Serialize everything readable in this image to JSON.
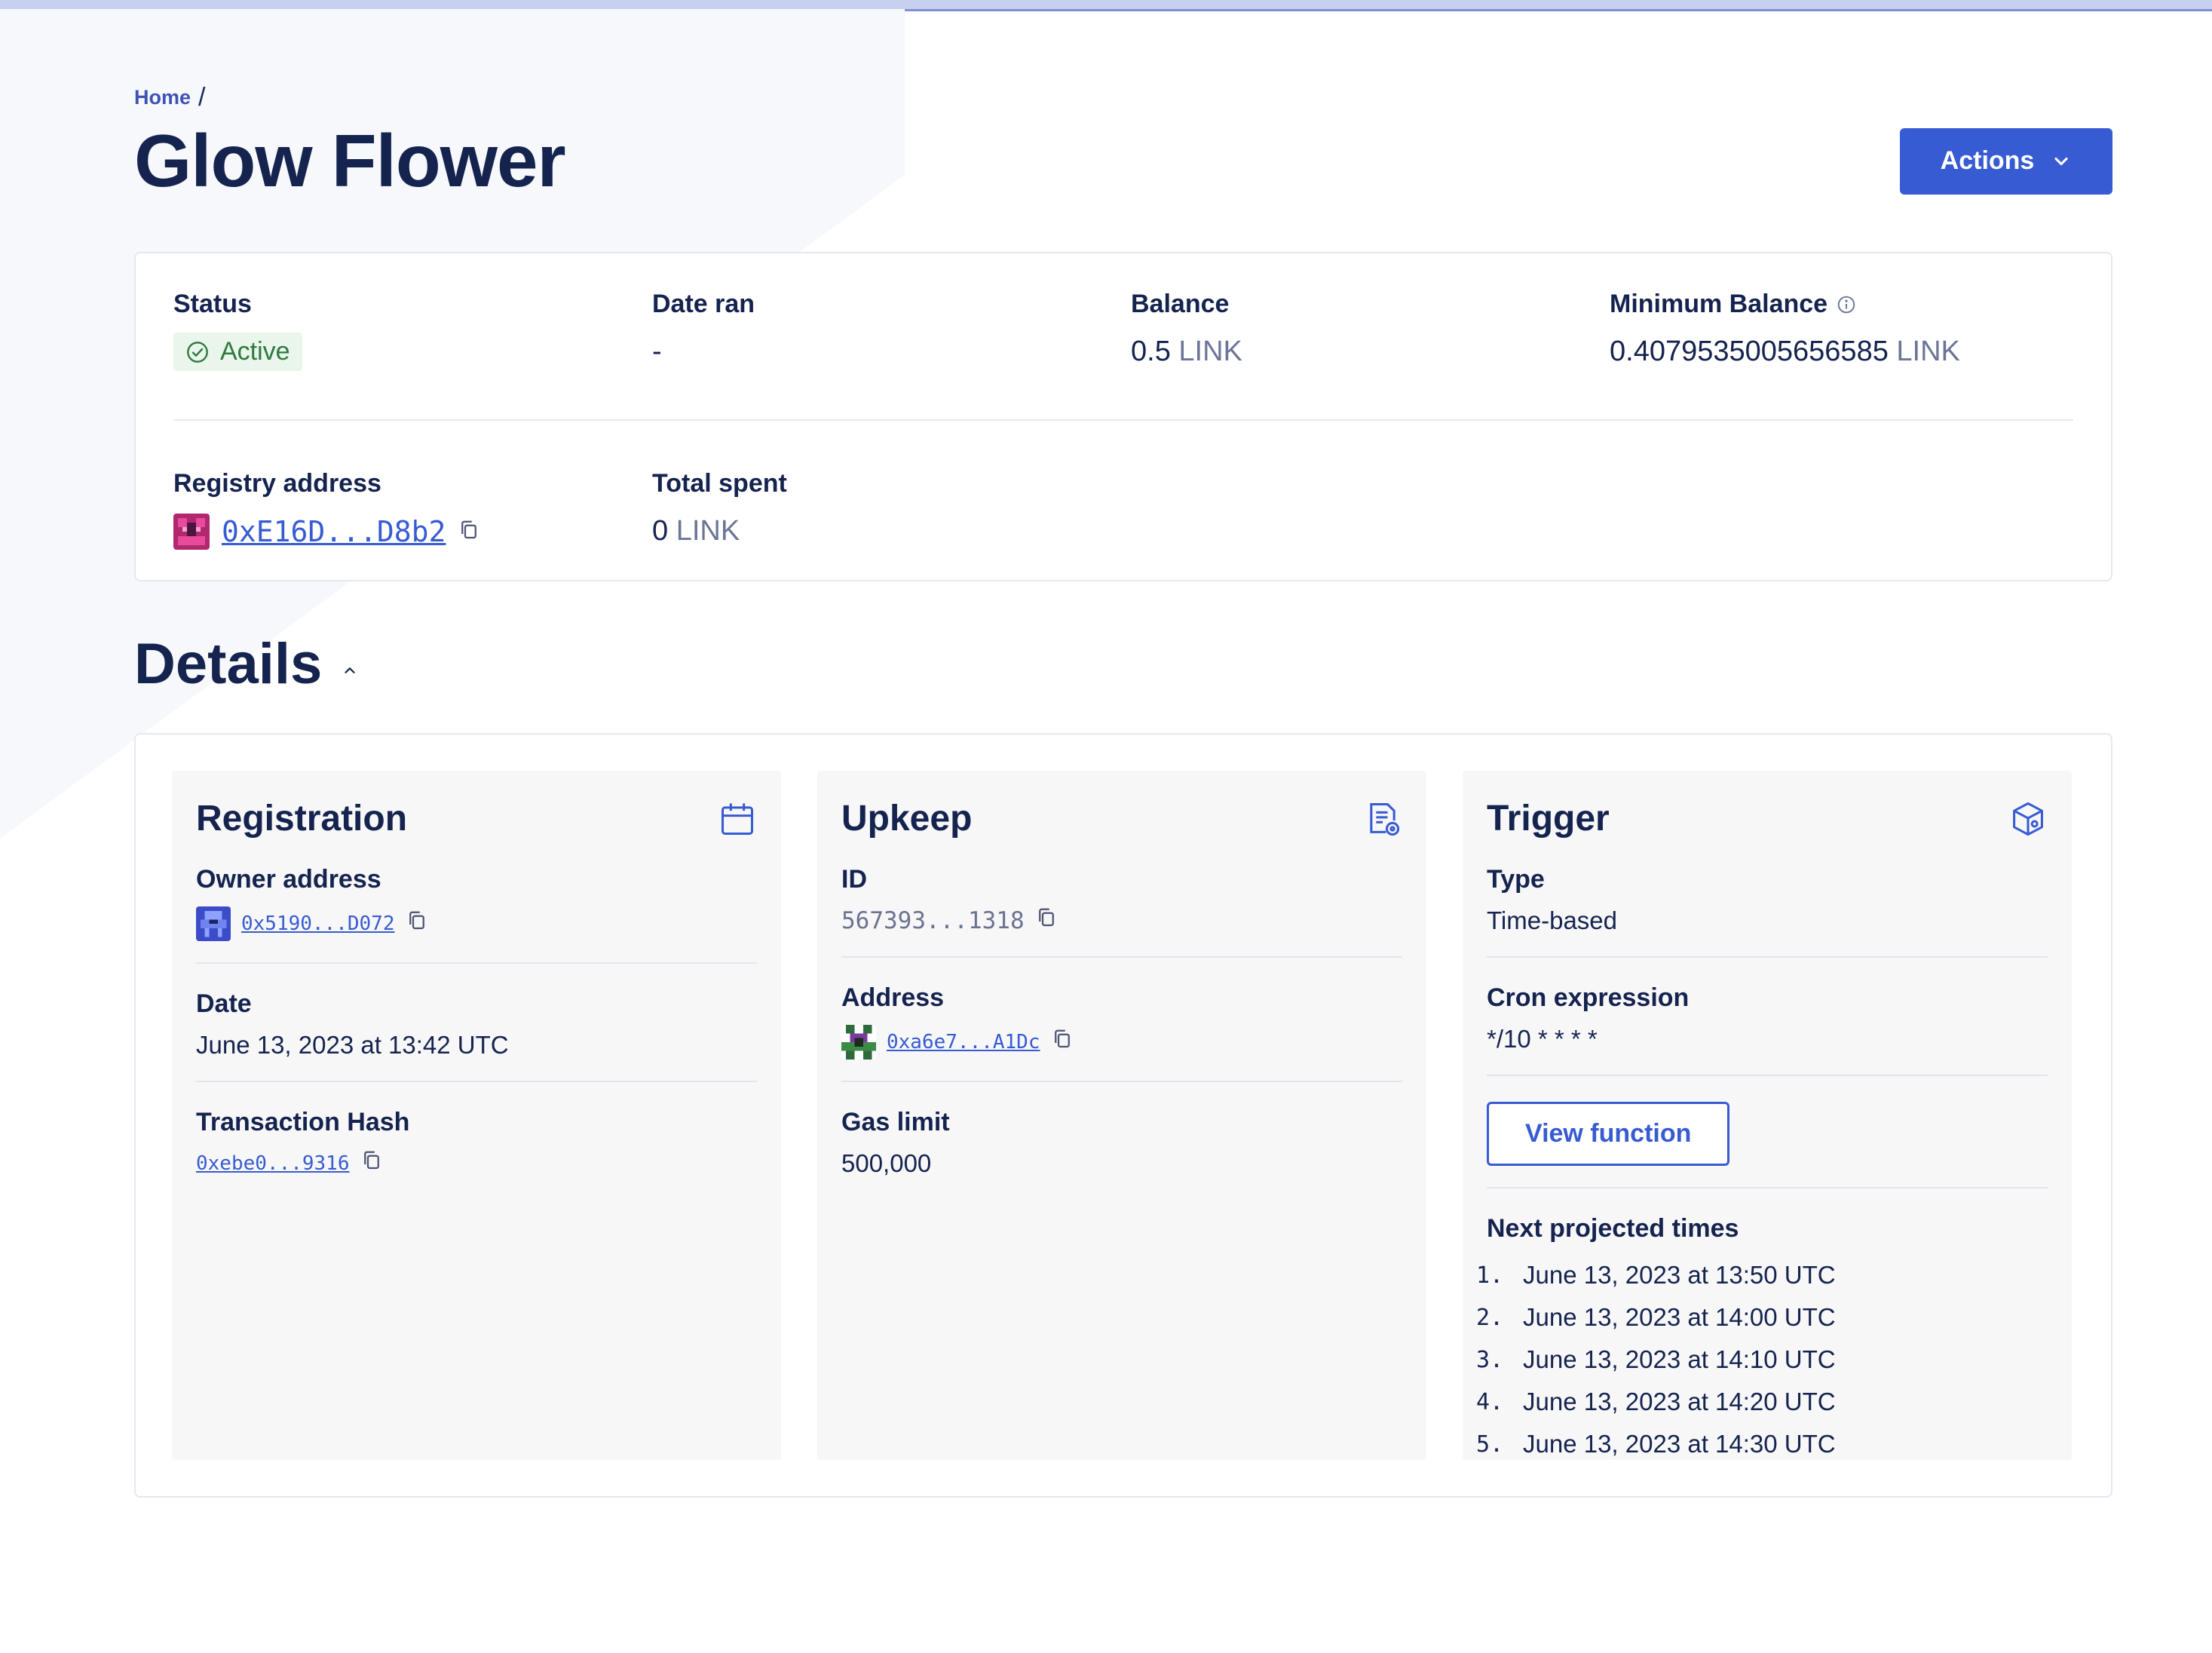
{
  "breadcrumb": {
    "home": "Home",
    "separator": "/"
  },
  "page": {
    "title": "Glow Flower"
  },
  "actions": {
    "label": "Actions",
    "icon": "chevron-down-icon"
  },
  "summary": {
    "status": {
      "label": "Status",
      "value": "Active",
      "color": "#2d7a3d"
    },
    "date_ran": {
      "label": "Date ran",
      "value": "-"
    },
    "balance": {
      "label": "Balance",
      "amount": "0.5",
      "unit": "LINK"
    },
    "min_balance": {
      "label": "Minimum Balance",
      "amount": "0.4079535005656585",
      "unit": "LINK"
    },
    "registry": {
      "label": "Registry address",
      "address": "0xE16D...D8b2"
    },
    "total_spent": {
      "label": "Total spent",
      "amount": "0",
      "unit": "LINK"
    }
  },
  "details": {
    "title": "Details",
    "registration": {
      "title": "Registration",
      "owner_label": "Owner address",
      "owner_value": "0x5190...D072",
      "date_label": "Date",
      "date_value": "June 13, 2023 at 13:42 UTC",
      "tx_label": "Transaction Hash",
      "tx_value": "0xebe0...9316"
    },
    "upkeep": {
      "title": "Upkeep",
      "id_label": "ID",
      "id_value": "567393...1318",
      "address_label": "Address",
      "address_value": "0xa6e7...A1Dc",
      "gas_label": "Gas limit",
      "gas_value": "500,000"
    },
    "trigger": {
      "title": "Trigger",
      "type_label": "Type",
      "type_value": "Time-based",
      "cron_label": "Cron expression",
      "cron_value": "*/10 * * * *",
      "view_button": "View function",
      "next_label": "Next projected times",
      "times": [
        {
          "n": "1.",
          "t": "June 13, 2023 at 13:50 UTC"
        },
        {
          "n": "2.",
          "t": "June 13, 2023 at 14:00 UTC"
        },
        {
          "n": "3.",
          "t": "June 13, 2023 at 14:10 UTC"
        },
        {
          "n": "4.",
          "t": "June 13, 2023 at 14:20 UTC"
        },
        {
          "n": "5.",
          "t": "June 13, 2023 at 14:30 UTC"
        }
      ]
    }
  },
  "colors": {
    "accent": "#375bd2",
    "heading": "#15234f",
    "success": "#2d7a3d"
  }
}
